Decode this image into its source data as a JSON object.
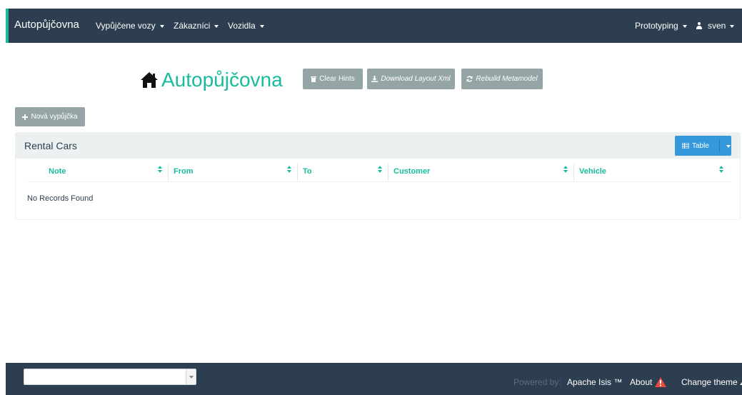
{
  "navbar": {
    "brand": "Autopůjčovna",
    "menus": [
      "Vypůjčene vozy",
      "Zákazníci",
      "Vozidla"
    ],
    "prototyping": "Prototyping",
    "user": "sven"
  },
  "header": {
    "title": "Autopůjčovna",
    "clear_hints": "Clear Hints",
    "download_layout": "Download Layout Xml",
    "rebuild_metamodel": "Rebuild Metamodel"
  },
  "actions": {
    "new_rental": "Nová vypůjčka"
  },
  "panel": {
    "title": "Rental Cars",
    "view_button": "Table",
    "columns": [
      "Note",
      "From",
      "To",
      "Customer",
      "Vehicle"
    ],
    "empty_message": "No Records Found"
  },
  "footer": {
    "theme_select_value": "",
    "powered_by": "Powered by:",
    "framework": "Apache Isis ™",
    "about": "About",
    "change_theme": "Change theme"
  },
  "colors": {
    "navbar": "#2c3e50",
    "accent": "#18bc9c",
    "button_gray": "#95a5a6",
    "button_blue": "#3498db",
    "warning": "#e74c3c"
  }
}
